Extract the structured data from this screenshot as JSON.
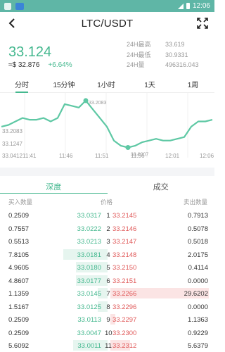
{
  "status_bar": {
    "time": "12:06"
  },
  "header": {
    "title": "LTC/USDT"
  },
  "ticker": {
    "price": "33.124",
    "usd_price": "≈$ 32.876",
    "change": "+6.64%",
    "high_label": "24H最高",
    "high_value": "33.619",
    "low_label": "24H最低",
    "low_value": "30.9331",
    "vol_label": "24H量",
    "vol_value": "496316.043"
  },
  "time_tabs": [
    "分时",
    "15分钟",
    "1小时",
    "1天",
    "1周"
  ],
  "active_time_tab": 0,
  "chart_data": {
    "type": "line",
    "x_ticks": [
      "11:41",
      "11:46",
      "11:51",
      "11:56",
      "12:01",
      "12:06"
    ],
    "y_labels": [
      "33.2083",
      "33.1247",
      "33.0412"
    ],
    "annotations": [
      "33.2083",
      "33.0007"
    ],
    "x": [
      0,
      1,
      2,
      3,
      4,
      5,
      6,
      7,
      8,
      9,
      10,
      11,
      12,
      13,
      14,
      15,
      16,
      17,
      18,
      19,
      20,
      21,
      22,
      23,
      24,
      25,
      26,
      27,
      28,
      29,
      30
    ],
    "values": [
      33.13,
      33.14,
      33.16,
      33.18,
      33.17,
      33.17,
      33.18,
      33.16,
      33.18,
      33.26,
      33.25,
      33.24,
      33.28,
      33.23,
      33.18,
      33.13,
      33.05,
      33.02,
      33.01,
      33.02,
      33.04,
      33.05,
      33.06,
      33.05,
      33.05,
      33.06,
      33.07,
      33.13,
      33.16,
      33.16,
      33.17
    ],
    "ylim": [
      33.0,
      33.3
    ],
    "color": "#5ec8a4"
  },
  "depth_tabs": [
    "深度",
    "成交"
  ],
  "book_headers": {
    "buy_qty": "买入数量",
    "price": "价格",
    "sell_qty": "卖出数量"
  },
  "book": [
    {
      "bq": "0.2509",
      "bp": "33.0317",
      "i": "1",
      "ap": "33.2145",
      "aq": "0.7913",
      "bw": 0,
      "aw": 0
    },
    {
      "bq": "0.7557",
      "bp": "33.0222",
      "i": "2",
      "ap": "33.2146",
      "aq": "0.5078",
      "bw": 0,
      "aw": 0
    },
    {
      "bq": "0.5513",
      "bp": "33.0213",
      "i": "3",
      "ap": "33.2147",
      "aq": "0.5018",
      "bw": 0,
      "aw": 0
    },
    {
      "bq": "7.8105",
      "bp": "33.0181",
      "i": "4",
      "ap": "33.2148",
      "aq": "2.0175",
      "bw": 0.45,
      "aw": 0
    },
    {
      "bq": "4.9605",
      "bp": "33.0180",
      "i": "5",
      "ap": "33.2150",
      "aq": "0.4114",
      "bw": 0.32,
      "aw": 0
    },
    {
      "bq": "4.8607",
      "bp": "33.0177",
      "i": "6",
      "ap": "33.2151",
      "aq": "0.0000",
      "bw": 0.32,
      "aw": 0
    },
    {
      "bq": "1.1359",
      "bp": "33.0145",
      "i": "7",
      "ap": "33.2266",
      "aq": "29.6202",
      "bw": 0.1,
      "aw": 1.0
    },
    {
      "bq": "1.5167",
      "bp": "33.0125",
      "i": "8",
      "ap": "33.2296",
      "aq": "0.0000",
      "bw": 0.1,
      "aw": 0
    },
    {
      "bq": "0.2509",
      "bp": "33.0113",
      "i": "9",
      "ap": "33.2297",
      "aq": "1.1363",
      "bw": 0,
      "aw": 0.05
    },
    {
      "bq": "0.2509",
      "bp": "33.0047",
      "i": "10",
      "ap": "33.2300",
      "aq": "0.9229",
      "bw": 0,
      "aw": 0
    },
    {
      "bq": "5.6092",
      "bp": "33.0011",
      "i": "11",
      "ap": "33.2312",
      "aq": "5.6379",
      "bw": 0.35,
      "aw": 0.2
    }
  ]
}
